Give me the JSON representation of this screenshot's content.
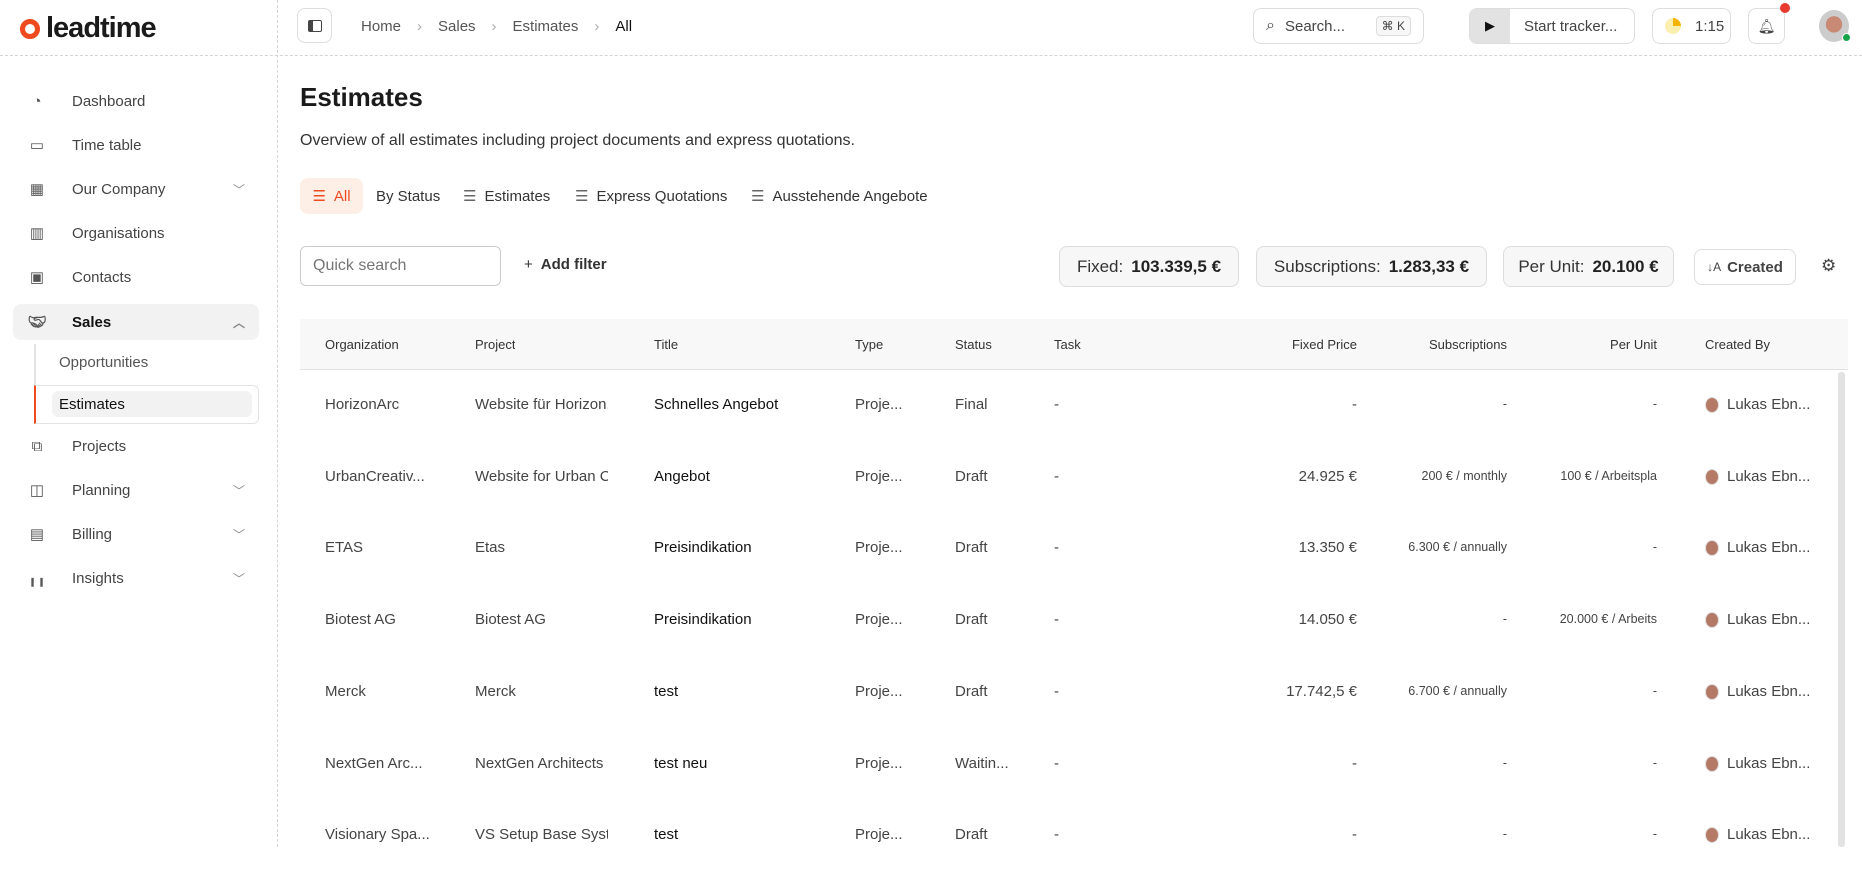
{
  "brand": {
    "name": "leadtime"
  },
  "header": {
    "breadcrumb": [
      "Home",
      "Sales",
      "Estimates",
      "All"
    ],
    "search_placeholder": "Search...",
    "search_shortcut": "⌘ K",
    "tracker_label": "Start tracker...",
    "timer": "1:15"
  },
  "sidebar": {
    "items": [
      {
        "label": "Dashboard",
        "icon": "gauge-icon"
      },
      {
        "label": "Time table",
        "icon": "calendar-icon"
      },
      {
        "label": "Our Company",
        "icon": "building-icon"
      },
      {
        "label": "Organisations",
        "icon": "organisation-icon"
      },
      {
        "label": "Contacts",
        "icon": "contact-icon"
      },
      {
        "label": "Sales",
        "icon": "handshake-icon"
      },
      {
        "label": "Projects",
        "icon": "project-tree-icon"
      },
      {
        "label": "Planning",
        "icon": "kanban-icon"
      },
      {
        "label": "Billing",
        "icon": "receipt-icon"
      },
      {
        "label": "Insights",
        "icon": "chart-icon"
      }
    ],
    "sales_sub": [
      "Opportunities",
      "Estimates"
    ]
  },
  "page": {
    "title": "Estimates",
    "subtitle": "Overview of all estimates including project documents and express quotations.",
    "tabs": [
      "All",
      "By Status",
      "Estimates",
      "Express Quotations",
      "Ausstehende Angebote"
    ]
  },
  "toolbar": {
    "quick_search_placeholder": "Quick search",
    "add_filter": "Add filter",
    "fixed_label": "Fixed:",
    "fixed_value": "103.339,5 €",
    "subs_label": "Subscriptions:",
    "subs_value": "1.283,33 €",
    "unit_label": "Per Unit:",
    "unit_value": "20.100 €",
    "sort_label": "Created"
  },
  "table": {
    "columns": [
      "Organization",
      "Project",
      "Title",
      "Type",
      "Status",
      "Task",
      "Fixed Price",
      "Subscriptions",
      "Per Unit",
      "Created By"
    ],
    "rows": [
      [
        "HorizonArc",
        "Website für Horizon.",
        "Schnelles Angebot",
        "Proje...",
        "Final",
        "-",
        "-",
        "-",
        "-",
        "Lukas Ebn..."
      ],
      [
        "UrbanCreativ...",
        "Website for Urban C",
        "Angebot",
        "Proje...",
        "Draft",
        "-",
        "24.925 €",
        "200 € / monthly",
        "100 € / Arbeitspla",
        "Lukas Ebn..."
      ],
      [
        "ETAS",
        "Etas",
        "Preisindikation",
        "Proje...",
        "Draft",
        "-",
        "13.350 €",
        "6.300 € / annually",
        "-",
        "Lukas Ebn..."
      ],
      [
        "Biotest AG",
        "Biotest AG",
        "Preisindikation",
        "Proje...",
        "Draft",
        "-",
        "14.050 €",
        "-",
        "20.000 € / Arbeits",
        "Lukas Ebn..."
      ],
      [
        "Merck",
        "Merck",
        "test",
        "Proje...",
        "Draft",
        "-",
        "17.742,5 €",
        "6.700 € / annually",
        "-",
        "Lukas Ebn..."
      ],
      [
        "NextGen Arc...",
        "NextGen Architects",
        "test neu",
        "Proje...",
        "Waitin...",
        "-",
        "-",
        "-",
        "-",
        "Lukas Ebn..."
      ],
      [
        "Visionary Spa...",
        "VS Setup Base Syst",
        "test",
        "Proje...",
        "Draft",
        "-",
        "-",
        "-",
        "-",
        "Lukas Ebn..."
      ]
    ]
  },
  "colors": {
    "accent": "#ee4a1e",
    "accent_bg": "#fdeee6"
  }
}
